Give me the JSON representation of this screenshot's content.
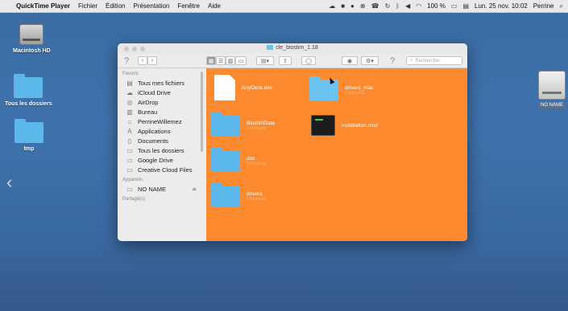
{
  "menubar": {
    "app_name": "QuickTime Player",
    "menus": [
      "Fichier",
      "Édition",
      "Présentation",
      "Fenêtre",
      "Aide"
    ],
    "battery": "100 %",
    "clock": "Lun. 25 nov. 10:02",
    "user": "Perrine"
  },
  "desktop": {
    "icons": [
      {
        "label": "Macintosh HD",
        "icon": "hard-drive-icon"
      },
      {
        "label": "Tous les dossiers",
        "icon": "folder-icon"
      },
      {
        "label": "tmp",
        "icon": "folder-icon"
      }
    ],
    "right_drive": {
      "label": "NO NAME",
      "icon": "external-drive-icon"
    }
  },
  "finder": {
    "title": "cle_biostim_1.18",
    "search_placeholder": "Rechercher",
    "sidebar": {
      "sections": [
        {
          "header": "Favoris",
          "items": [
            {
              "label": "Tous mes fichiers",
              "icon": "all-files-icon"
            },
            {
              "label": "iCloud Drive",
              "icon": "cloud-icon"
            },
            {
              "label": "AirDrop",
              "icon": "airdrop-icon"
            },
            {
              "label": "Bureau",
              "icon": "desktop-icon"
            },
            {
              "label": "PerrineWillemez",
              "icon": "home-icon"
            },
            {
              "label": "Applications",
              "icon": "applications-icon"
            },
            {
              "label": "Documents",
              "icon": "documents-icon"
            },
            {
              "label": "Tous les dossiers",
              "icon": "folder-icon"
            },
            {
              "label": "Google Drive",
              "icon": "folder-icon"
            },
            {
              "label": "Creative Cloud Files",
              "icon": "folder-icon"
            }
          ]
        },
        {
          "header": "Appareils",
          "items": [
            {
              "label": "NO NAME",
              "icon": "drive-icon"
            }
          ]
        },
        {
          "header": "Partagé(s)",
          "items": []
        }
      ]
    },
    "items": [
      {
        "name": "AnyDesk.exe",
        "kind": "document",
        "sub": ""
      },
      {
        "name": "drivers_mac",
        "kind": "folder",
        "sub": "2 éléments"
      },
      {
        "name": "BiostimData",
        "kind": "folder",
        "sub": "2 éléments"
      },
      {
        "name": "installation.cmd",
        "kind": "terminal",
        "sub": ""
      },
      {
        "name": "doc",
        "kind": "folder",
        "sub": "3 éléments"
      },
      {
        "name": "drivers",
        "kind": "folder",
        "sub": "2 éléments"
      }
    ]
  },
  "colors": {
    "desktop": "#3d6fa9",
    "content_background": "#fd8a2e",
    "folder_blue": "#5cb8ea"
  }
}
